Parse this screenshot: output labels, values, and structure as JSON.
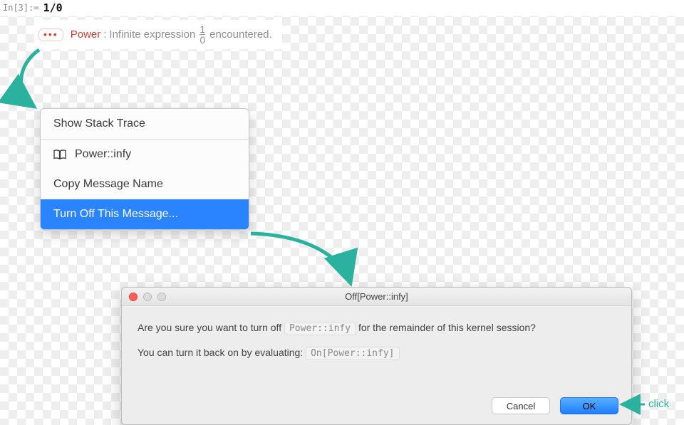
{
  "input": {
    "label": "In[3]:=",
    "code": "1/0"
  },
  "message": {
    "chip": "•••",
    "power": "Power",
    "colon": ":",
    "pre": "Infinite expression",
    "frac_num": "1",
    "frac_den": "0",
    "post": "encountered."
  },
  "menu": {
    "stack": "Show Stack Trace",
    "doc": "Power::infy",
    "copy": "Copy Message Name",
    "off": "Turn Off This Message..."
  },
  "dialog": {
    "title": "Off[Power::infy]",
    "q_before": "Are you sure you want to turn off",
    "q_chip": "Power::infy",
    "q_after": "for the remainder of this kernel session?",
    "hint_before": "You can turn it back on by evaluating:",
    "hint_chip": "On[Power::infy]",
    "cancel": "Cancel",
    "ok": "OK"
  },
  "annotation": {
    "click": "click"
  },
  "colors": {
    "teal": "#2ab29f",
    "blue": "#2a84ff",
    "red": "#d43b2e"
  }
}
